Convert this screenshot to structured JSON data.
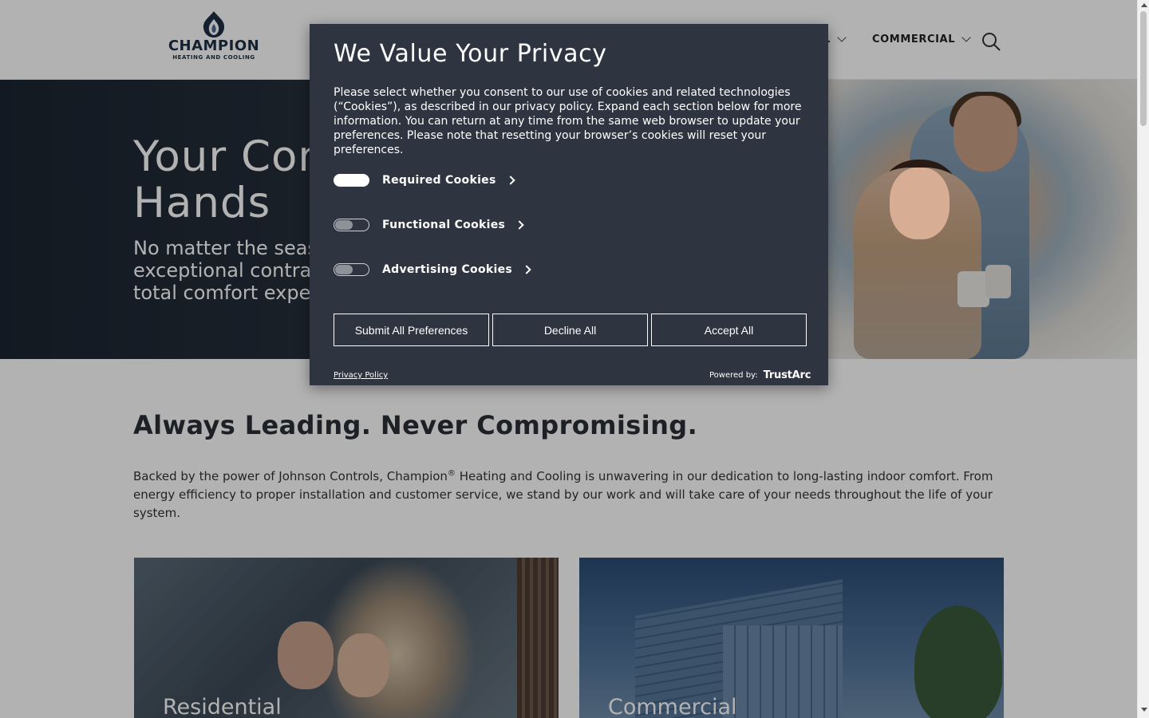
{
  "header": {
    "logo": {
      "brand": "CHAMPION",
      "sub": "HEATING AND COOLING"
    },
    "nav": [
      {
        "label": "L"
      },
      {
        "label": "COMMERCIAL"
      }
    ],
    "search_icon": "search-icon"
  },
  "hero": {
    "title": "Your Comfort Is In Good Hands",
    "subtitle": "No matter the season, Champion has exceptional contractors ready to deliver a total comfort experience."
  },
  "intro": {
    "title": "Always Leading. Never Compromising.",
    "text_before": "Backed by the power of Johnson Controls, Champion",
    "reg": "®",
    "text_after": " Heating and Cooling is unwavering in our dedication to long-lasting indoor comfort. From energy efficiency to proper installation and customer service, we stand by our work and will take care of your needs throughout the life of your system."
  },
  "cards": [
    {
      "label": "Residential"
    },
    {
      "label": "Commercial"
    }
  ],
  "privacy_modal": {
    "title": "We Value Your Privacy",
    "description": "Please select whether you consent to our use of cookies and related technologies (“Cookies”), as described in our privacy policy. Expand each section below for more information. You can return at any time from the same web browser to update your preferences. Please note that resetting your browser’s cookies will reset your preferences.",
    "categories": [
      {
        "label": "Required Cookies",
        "enabled": true
      },
      {
        "label": "Functional Cookies",
        "enabled": false
      },
      {
        "label": "Advertising Cookies",
        "enabled": false
      }
    ],
    "buttons": {
      "submit": "Submit All Preferences",
      "decline": "Decline All",
      "accept": "Accept All"
    },
    "privacy_link": "Privacy Policy",
    "powered_by": "Powered by:",
    "vendor": "TrustArc"
  },
  "colors": {
    "modal_bg": "#2e3440",
    "brand_navy": "#1f2f44"
  }
}
